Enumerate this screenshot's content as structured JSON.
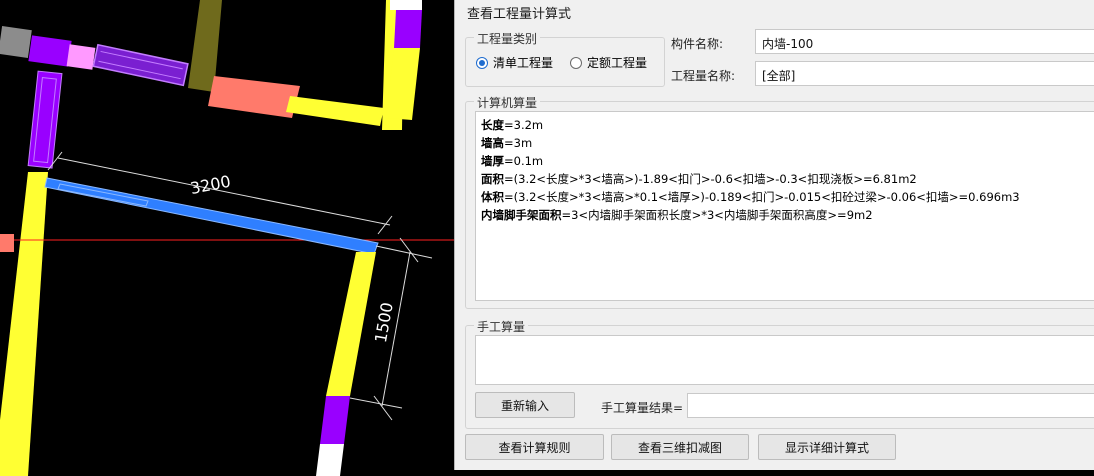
{
  "drawing": {
    "dim_horizontal": "3200",
    "dim_vertical": "1500"
  },
  "dialog": {
    "title": "查看工程量计算式",
    "qty_type_group": {
      "label": "工程量类别",
      "options": [
        {
          "label": "清单工程量",
          "checked": true
        },
        {
          "label": "定额工程量",
          "checked": false
        }
      ]
    },
    "component_name_label": "构件名称:",
    "component_name_value": "内墙-100",
    "qty_name_label": "工程量名称:",
    "qty_name_value": "[全部]",
    "computer_calc": {
      "label": "计算机算量",
      "lines": [
        {
          "name": "长度",
          "expr": "=3.2m"
        },
        {
          "name": "墙高",
          "expr": "=3m"
        },
        {
          "name": "墙厚",
          "expr": "=0.1m"
        },
        {
          "name": "面积",
          "expr": "=(3.2<长度>*3<墙高>)-1.89<扣门>-0.6<扣墙>-0.3<扣现浇板>=6.81m2"
        },
        {
          "name": "体积",
          "expr": "=(3.2<长度>*3<墙高>*0.1<墙厚>)-0.189<扣门>-0.015<扣砼过梁>-0.06<扣墙>=0.696m3"
        },
        {
          "name": "内墙脚手架面积",
          "expr": "=3<内墙脚手架面积长度>*3<内墙脚手架面积高度>=9m2"
        }
      ]
    },
    "manual_calc": {
      "label": "手工算量",
      "reinput_button": "重新输入",
      "result_label": "手工算量结果=",
      "result_value": ""
    },
    "buttons": {
      "view_rules": "查看计算规则",
      "view_3d": "查看三维扣减图",
      "show_detail": "显示详细计算式"
    }
  }
}
